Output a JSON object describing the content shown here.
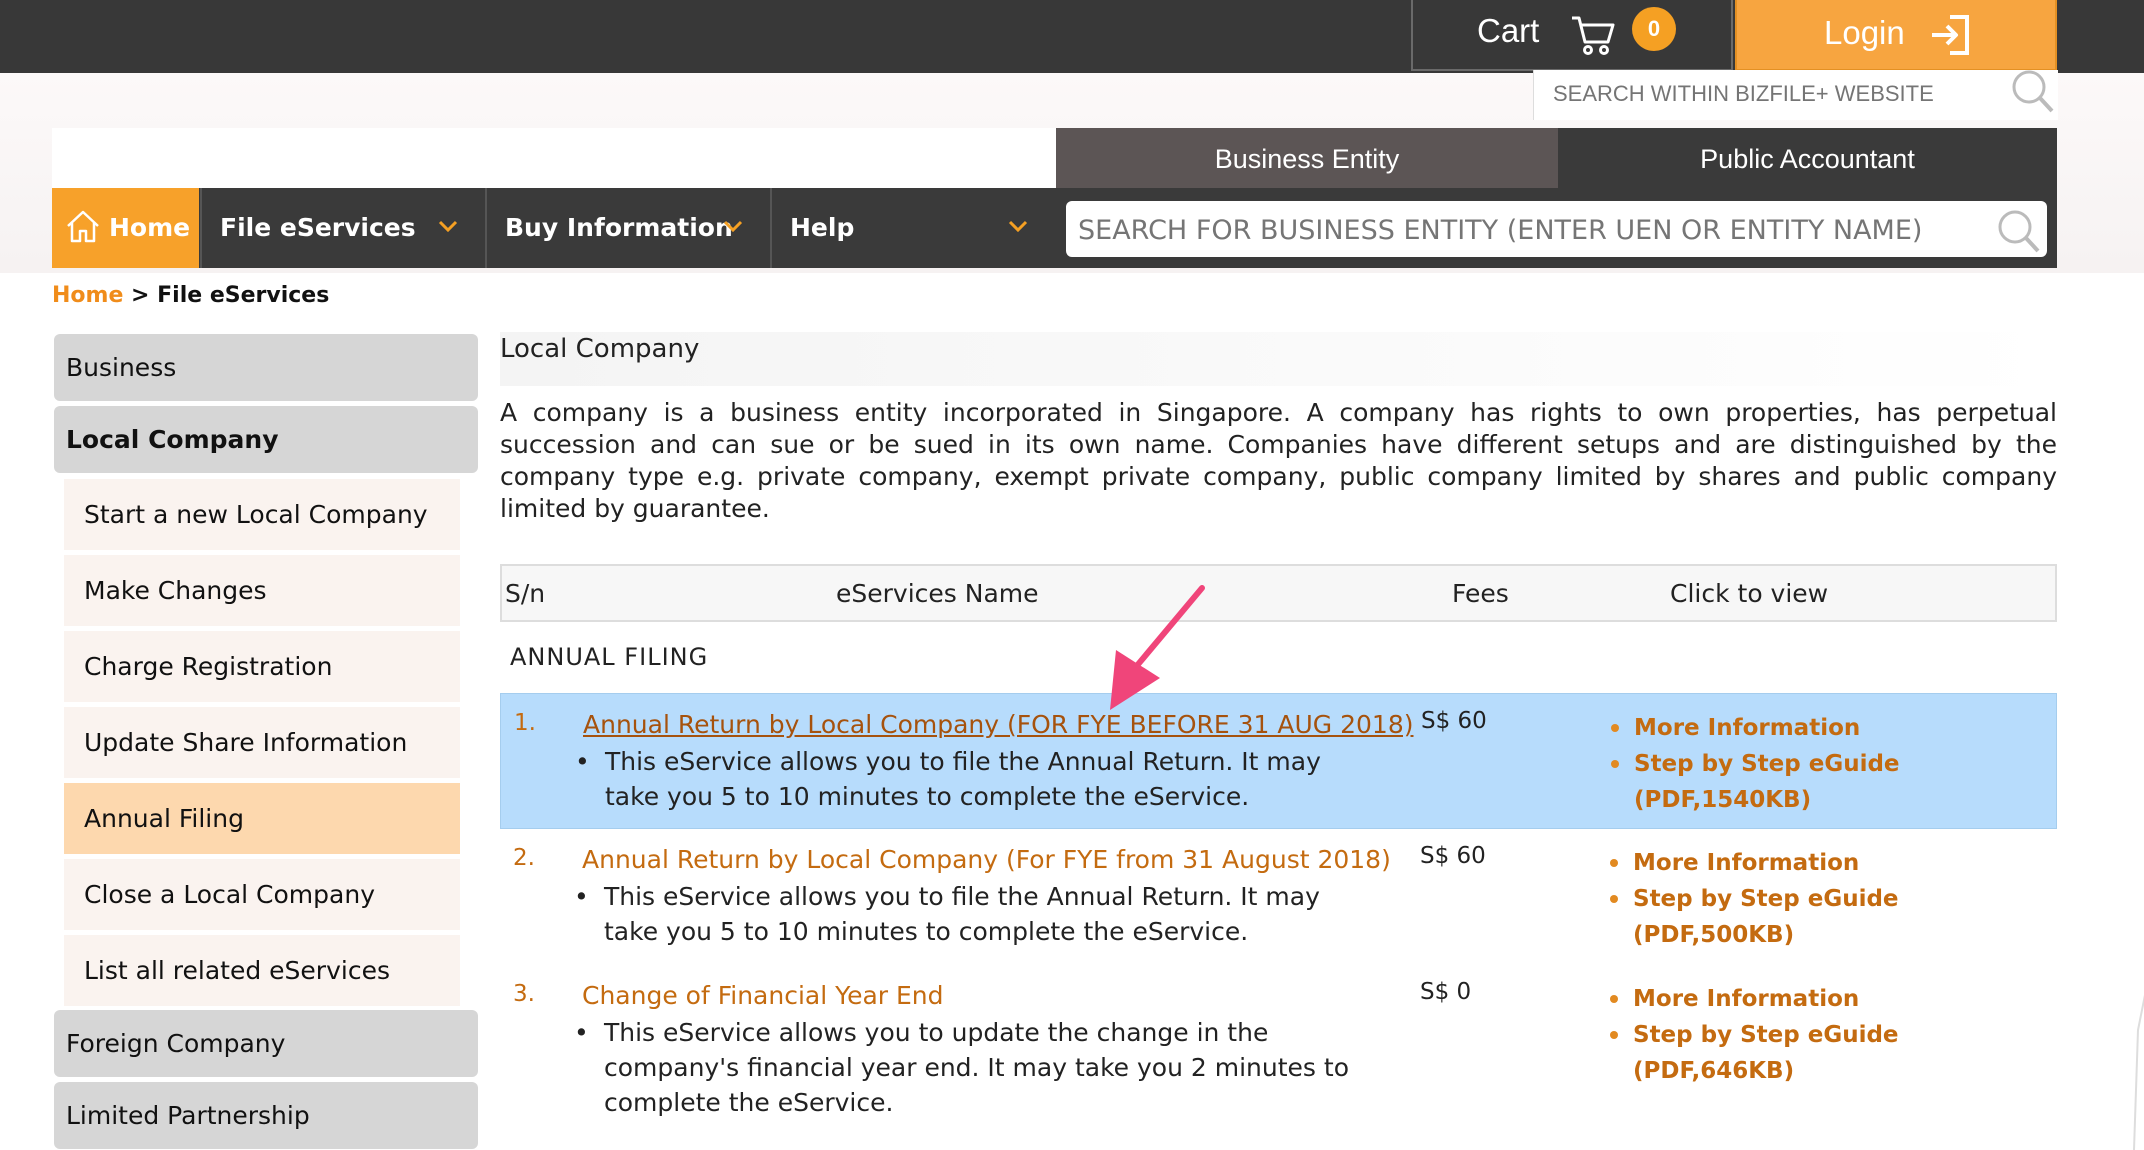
{
  "header": {
    "cart_label": "Cart",
    "cart_count": "0",
    "login_label": "Login",
    "site_search_placeholder": "SEARCH WITHIN BIZFILE+ WEBSITE"
  },
  "entity_tabs": {
    "business": "Business Entity",
    "accountant": "Public Accountant"
  },
  "nav": {
    "home": "Home",
    "file": "File eServices",
    "buy": "Buy Information",
    "help": "Help",
    "entity_search_placeholder": "SEARCH FOR BUSINESS ENTITY (ENTER UEN OR ENTITY NAME)"
  },
  "breadcrumb": {
    "home": "Home",
    "sep": " > ",
    "current": "File eServices"
  },
  "sidebar": {
    "business": "Business",
    "local_company": "Local Company",
    "sub": [
      "Start a new Local Company",
      "Make Changes",
      "Charge Registration",
      "Update Share Information",
      "Annual Filing",
      "Close a Local Company",
      "List all related eServices"
    ],
    "foreign_company": "Foreign Company",
    "limited_partnership": "Limited Partnership"
  },
  "content": {
    "title": "Local Company",
    "description": "A company is a business entity incorporated in Singapore. A company has rights to own properties, has perpetual succession and can sue or be sued in its own name. Companies have different setups and are distinguished by the company type e.g. private company, exempt private company, public company limited by shares and public company limited by guarantee."
  },
  "table": {
    "headers": {
      "sn": "S/n",
      "name": "eServices Name",
      "fees": "Fees",
      "view": "Click to view"
    },
    "section": "ANNUAL FILING",
    "rows": [
      {
        "sn": "1.",
        "name": "Annual Return by Local Company (FOR FYE BEFORE 31 AUG 2018)",
        "desc": "This eService allows you to file the Annual Return. It may take you 5 to 10 minutes to complete the eService.",
        "fee": "S$ 60",
        "link1": "More Information",
        "link2": "Step by Step eGuide (PDF,1540KB)"
      },
      {
        "sn": "2.",
        "name": "Annual Return by Local Company (For FYE from 31 August 2018)",
        "desc": "This eService allows you to file the Annual Return. It may take you 5 to 10 minutes to complete the eService.",
        "fee": "S$ 60",
        "link1": "More Information",
        "link2": "Step by Step eGuide (PDF,500KB)"
      },
      {
        "sn": "3.",
        "name": "Change of Financial Year End",
        "desc": "This eService allows you to update the change in the company's financial year end. It may take you 2 minutes to complete the eService.",
        "fee": "S$ 0",
        "link1": "More Information",
        "link2": "Step by Step eGuide (PDF,646KB)"
      }
    ]
  },
  "colors": {
    "accent_orange": "#f7a12a",
    "link_orange": "#c46b10",
    "highlight_row": "#b7dcfc",
    "annotation_arrow": "#f0457a"
  },
  "icons": [
    "cart-icon",
    "sign-in-icon",
    "search-icon",
    "home-icon",
    "chevron-down-icon",
    "annotation-arrow-icon"
  ]
}
